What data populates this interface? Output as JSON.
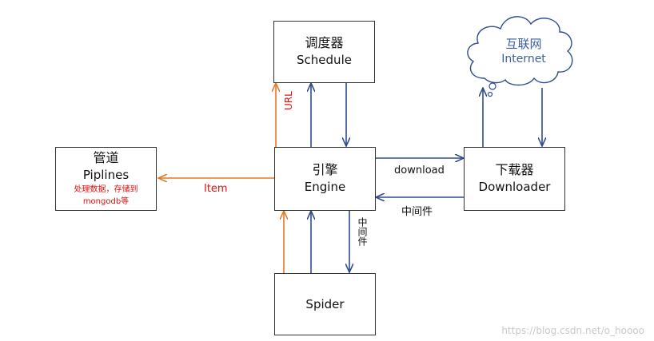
{
  "nodes": {
    "scheduler": {
      "cn": "调度器",
      "en": "Schedule"
    },
    "engine": {
      "cn": "引擎",
      "en": "Engine"
    },
    "downloader": {
      "cn": "下载器",
      "en": "Downloader"
    },
    "pipelines": {
      "cn": "管道",
      "en": "Piplines",
      "note1": "处理数据，存储到",
      "note2": "mongodb等"
    },
    "spider": {
      "en": "Spider"
    },
    "internet": {
      "cn": "互联网",
      "en": "Internet"
    }
  },
  "labels": {
    "url": "URL",
    "item": "Item",
    "download": "download",
    "middleware_h": "中间件",
    "middleware_v": "中间件"
  },
  "colors": {
    "orange": "#e87722",
    "blue": "#2f4b8f",
    "red": "#e01010"
  },
  "watermark": "https://blog.csdn.net/o_hoooo"
}
